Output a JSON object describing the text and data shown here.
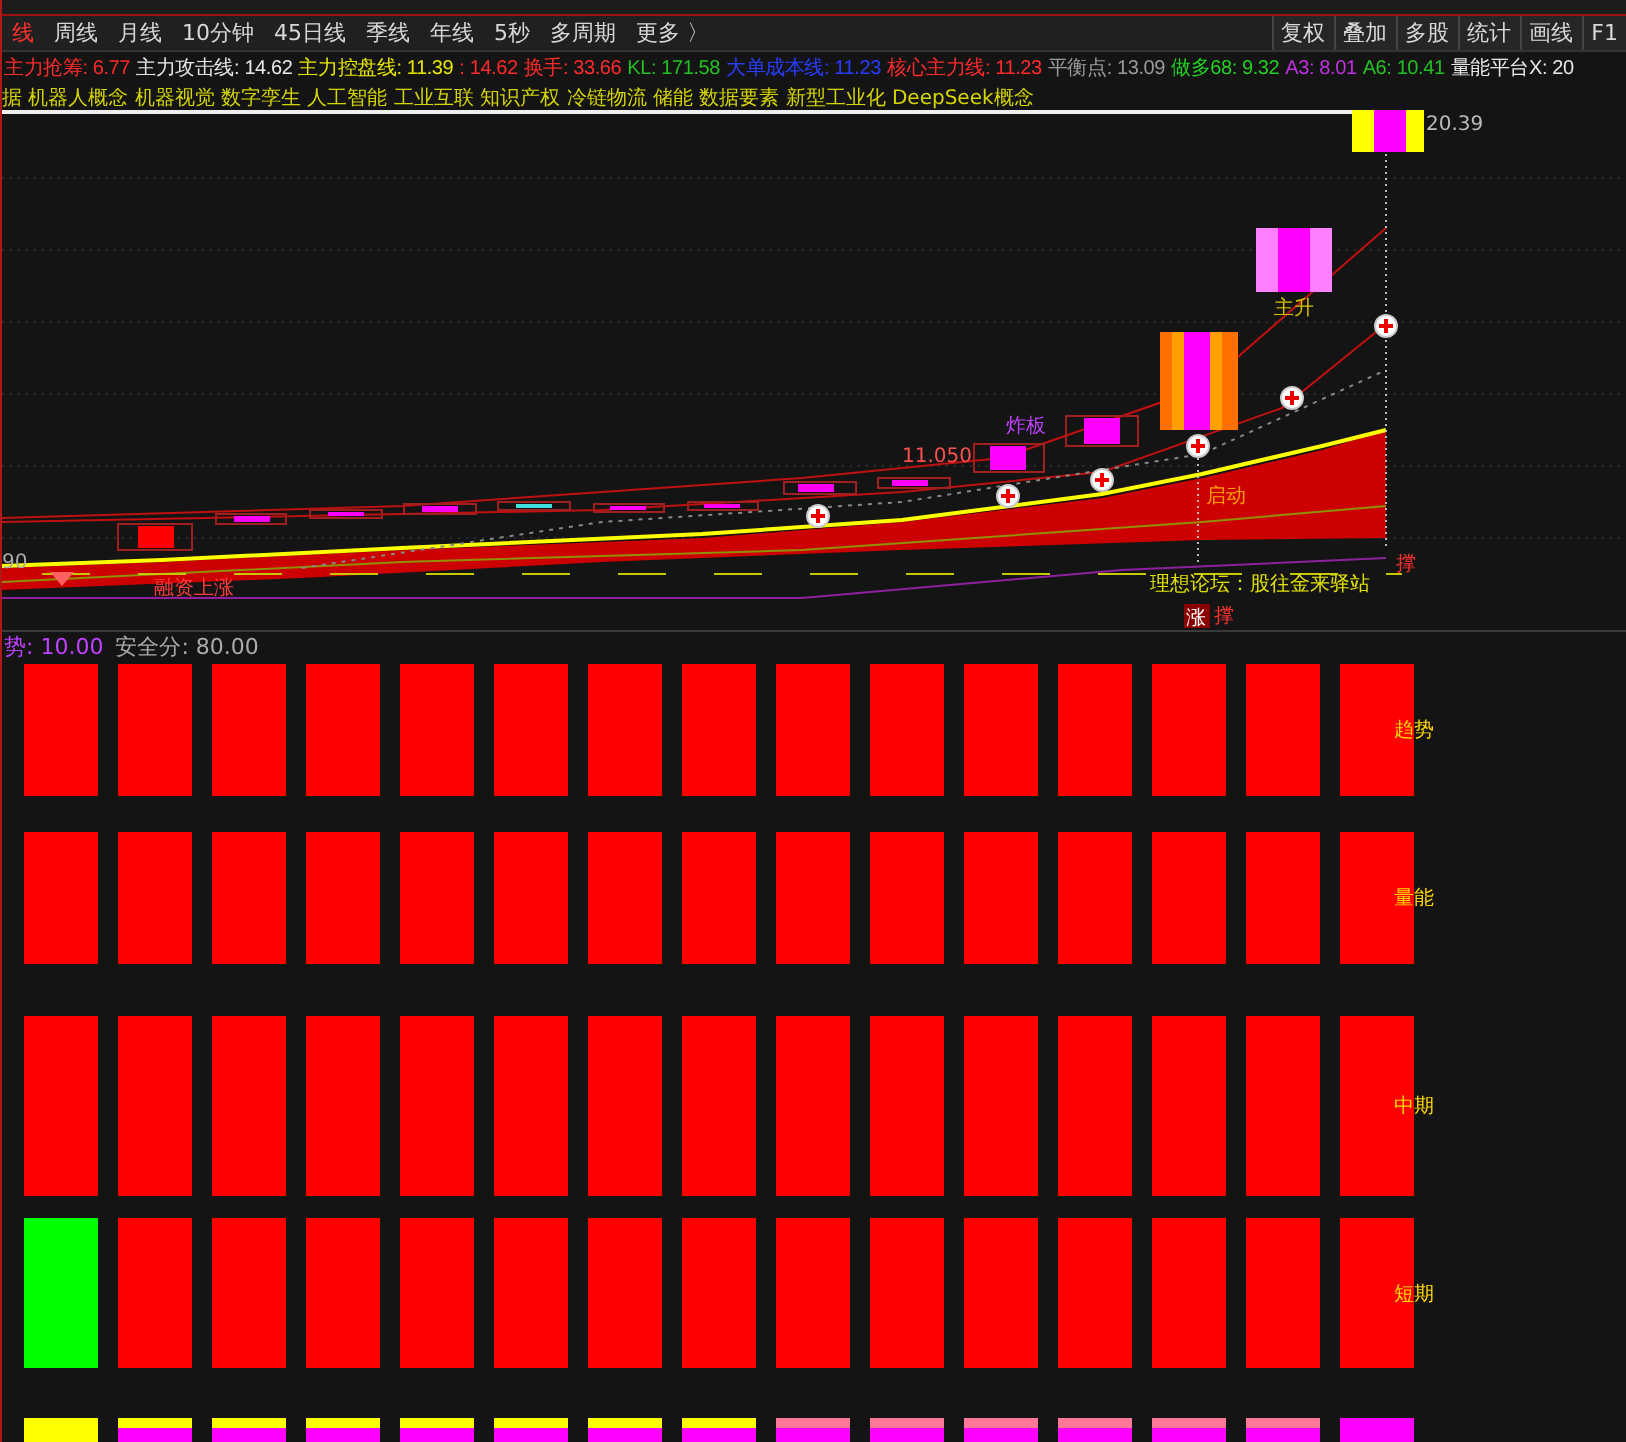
{
  "period_tabs": [
    {
      "label": "线",
      "selected": true
    },
    {
      "label": "周线",
      "selected": false
    },
    {
      "label": "月线",
      "selected": false
    },
    {
      "label": "10分钟",
      "selected": false
    },
    {
      "label": "45日线",
      "selected": false
    },
    {
      "label": "季线",
      "selected": false
    },
    {
      "label": "年线",
      "selected": false
    },
    {
      "label": "5秒",
      "selected": false
    },
    {
      "label": "多周期",
      "selected": false
    },
    {
      "label": "更多 〉",
      "selected": false
    }
  ],
  "toolbar_buttons": [
    "复权",
    "叠加",
    "多股",
    "统计",
    "画线",
    "F1"
  ],
  "indicators": [
    {
      "text": "主力抢筹: 6.77",
      "color": "#ff2a2a"
    },
    {
      "text": "主力攻击线: 14.62",
      "color": "#e8e8e8"
    },
    {
      "text": "主力控盘线: 11.39",
      "color": "#e6e600"
    },
    {
      "text": ": 14.62",
      "color": "#ff2a2a"
    },
    {
      "text": "换手: 33.66",
      "color": "#ff2a2a"
    },
    {
      "text": "KL: 171.58",
      "color": "#22c022"
    },
    {
      "text": "大单成本线: 11.23",
      "color": "#2a3cff"
    },
    {
      "text": "核心主力线: 11.23",
      "color": "#ff2a2a"
    },
    {
      "text": "平衡点: 13.09",
      "color": "#9a9a9a"
    },
    {
      "text": "做多68: 9.32",
      "color": "#22d022"
    },
    {
      "text": "A3: 8.01",
      "color": "#c030e0"
    },
    {
      "text": "A6: 10.41",
      "color": "#22c022"
    },
    {
      "text": "量能平台X: 20",
      "color": "#e8e8e8"
    }
  ],
  "concepts": "据 机器人概念 机器视觉 数字孪生 人工智能 工业互联 知识产权 冷链物流 储能 数据要素 新型工业化 DeepSeek概念",
  "chart": {
    "axis_label": "90",
    "high_price": "20.39",
    "stage_label": "主升",
    "break_label": "炸板",
    "break_price": "11.050",
    "start_label": "启动",
    "left_label": "融资上涨",
    "forum_label": "理想论坛：股往金来驿站",
    "rise_badge": "涨",
    "support_marks": [
      "撑",
      "撑"
    ]
  },
  "score_bar": [
    {
      "text": "势: 10.00",
      "color": "#c040ff"
    },
    {
      "text": "安全分: 80.00",
      "color": "#aaaaaa"
    }
  ],
  "signal_rows": [
    {
      "label": "趋势",
      "cells": [
        {
          "color": "#ff0000"
        },
        {
          "color": "#ff0000"
        },
        {
          "color": "#ff0000"
        },
        {
          "color": "#ff0000"
        },
        {
          "color": "#ff0000"
        },
        {
          "color": "#ff0000"
        },
        {
          "color": "#ff0000"
        },
        {
          "color": "#ff0000"
        },
        {
          "color": "#ff0000"
        },
        {
          "color": "#ff0000"
        },
        {
          "color": "#ff0000"
        },
        {
          "color": "#ff0000"
        },
        {
          "color": "#ff0000"
        },
        {
          "color": "#ff0000"
        },
        {
          "color": "#ff0000"
        }
      ]
    },
    {
      "label": "量能",
      "cells": [
        {
          "color": "#ff0000"
        },
        {
          "color": "#ff0000"
        },
        {
          "color": "#ff0000"
        },
        {
          "color": "#ff0000"
        },
        {
          "color": "#ff0000"
        },
        {
          "color": "#ff0000"
        },
        {
          "color": "#ff0000"
        },
        {
          "color": "#ff0000"
        },
        {
          "color": "#ff0000"
        },
        {
          "color": "#ff0000"
        },
        {
          "color": "#ff0000"
        },
        {
          "color": "#ff0000"
        },
        {
          "color": "#ff0000"
        },
        {
          "color": "#ff0000"
        },
        {
          "color": "#ff0000"
        }
      ]
    },
    {
      "label": "中期",
      "cells": [
        {
          "color": "#ff0000"
        },
        {
          "color": "#ff0000"
        },
        {
          "color": "#ff0000"
        },
        {
          "color": "#ff0000"
        },
        {
          "color": "#ff0000"
        },
        {
          "color": "#ff0000"
        },
        {
          "color": "#ff0000"
        },
        {
          "color": "#ff0000"
        },
        {
          "color": "#ff0000"
        },
        {
          "color": "#ff0000"
        },
        {
          "color": "#ff0000"
        },
        {
          "color": "#ff0000"
        },
        {
          "color": "#ff0000"
        },
        {
          "color": "#ff0000"
        },
        {
          "color": "#ff0000"
        }
      ]
    },
    {
      "label": "短期",
      "cells": [
        {
          "color": "#00ff00"
        },
        {
          "color": "#ff0000"
        },
        {
          "color": "#ff0000"
        },
        {
          "color": "#ff0000"
        },
        {
          "color": "#ff0000"
        },
        {
          "color": "#ff0000"
        },
        {
          "color": "#ff0000"
        },
        {
          "color": "#ff0000"
        },
        {
          "color": "#ff0000"
        },
        {
          "color": "#ff0000"
        },
        {
          "color": "#ff0000"
        },
        {
          "color": "#ff0000"
        },
        {
          "color": "#ff0000"
        },
        {
          "color": "#ff0000"
        },
        {
          "color": "#ff0000"
        }
      ]
    },
    {
      "cells": [
        {
          "segments": [
            {
              "color": "#ffff00"
            }
          ]
        },
        {
          "segments": [
            {
              "color": "#ffff00"
            },
            {
              "color": "#ff00ff"
            }
          ]
        },
        {
          "segments": [
            {
              "color": "#ffff00"
            },
            {
              "color": "#ff00ff"
            }
          ]
        },
        {
          "segments": [
            {
              "color": "#ffff00"
            },
            {
              "color": "#ff00ff"
            }
          ]
        },
        {
          "segments": [
            {
              "color": "#ffff00"
            },
            {
              "color": "#ff00ff"
            }
          ]
        },
        {
          "segments": [
            {
              "color": "#ffff00"
            },
            {
              "color": "#ff00ff"
            }
          ]
        },
        {
          "segments": [
            {
              "color": "#ffff00"
            },
            {
              "color": "#ff00ff"
            }
          ]
        },
        {
          "segments": [
            {
              "color": "#ffff00"
            },
            {
              "color": "#ff00ff"
            }
          ]
        },
        {
          "segments": [
            {
              "color": "#ff7898"
            },
            {
              "color": "#ff00ff"
            }
          ]
        },
        {
          "segments": [
            {
              "color": "#ff7898"
            },
            {
              "color": "#ff00ff"
            }
          ]
        },
        {
          "segments": [
            {
              "color": "#ff7898"
            },
            {
              "color": "#ff00ff"
            }
          ]
        },
        {
          "segments": [
            {
              "color": "#ff7898"
            },
            {
              "color": "#ff00ff"
            }
          ]
        },
        {
          "segments": [
            {
              "color": "#ff7898"
            },
            {
              "color": "#ff00ff"
            }
          ]
        },
        {
          "segments": [
            {
              "color": "#ff7898"
            },
            {
              "color": "#ff00ff"
            }
          ]
        },
        {
          "segments": [
            {
              "color": "#ff00ff"
            }
          ]
        }
      ]
    }
  ]
}
